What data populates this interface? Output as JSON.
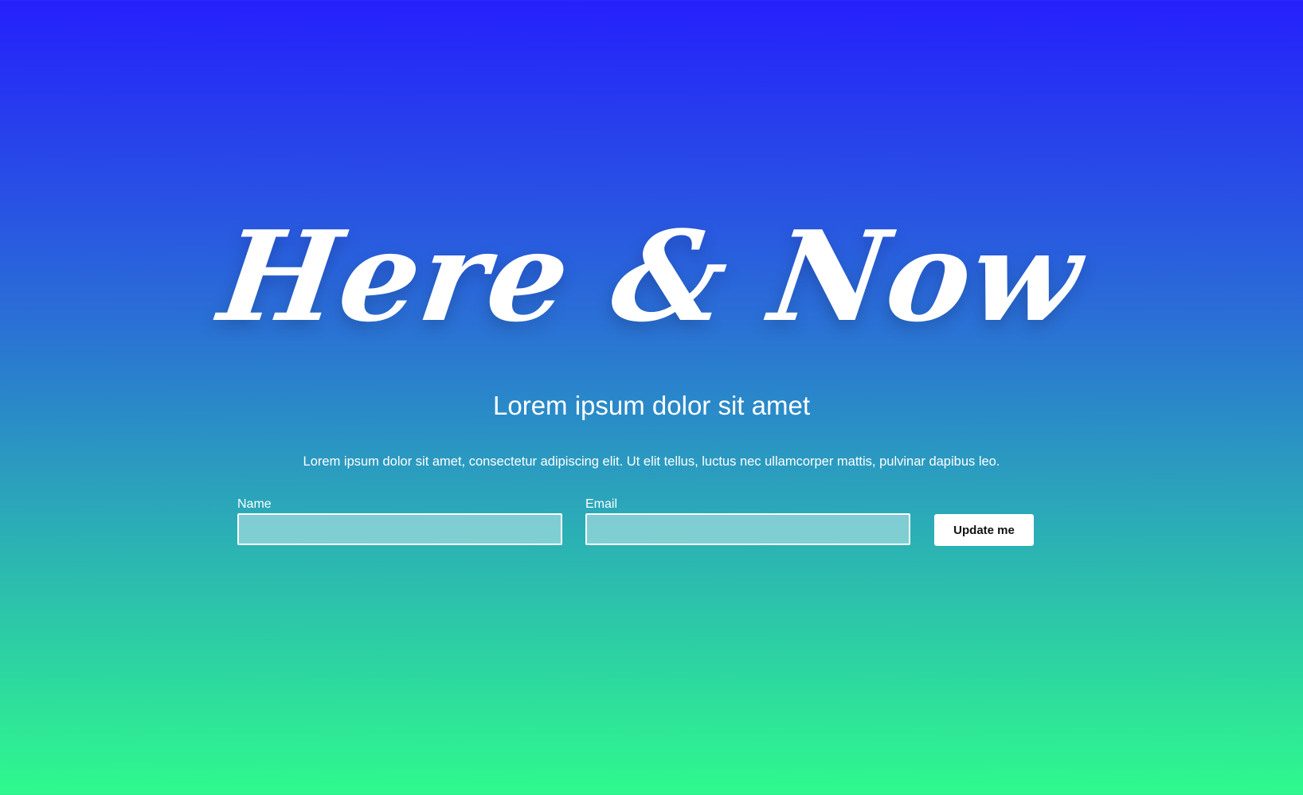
{
  "hero": {
    "headline": "Here & Now",
    "subtitle": "Lorem ipsum dolor sit amet",
    "body": "Lorem ipsum dolor sit amet, consectetur adipiscing elit. Ut elit tellus, luctus nec ullamcorper mattis, pulvinar dapibus leo."
  },
  "form": {
    "name": {
      "label": "Name",
      "value": "",
      "placeholder": ""
    },
    "email": {
      "label": "Email",
      "value": "",
      "placeholder": ""
    },
    "submit_label": "Update me"
  },
  "colors": {
    "gradient_top": "#2520fc",
    "gradient_bottom": "#2ffa8d",
    "text": "#ffffff",
    "button_bg": "#ffffff",
    "button_text": "#111111"
  }
}
